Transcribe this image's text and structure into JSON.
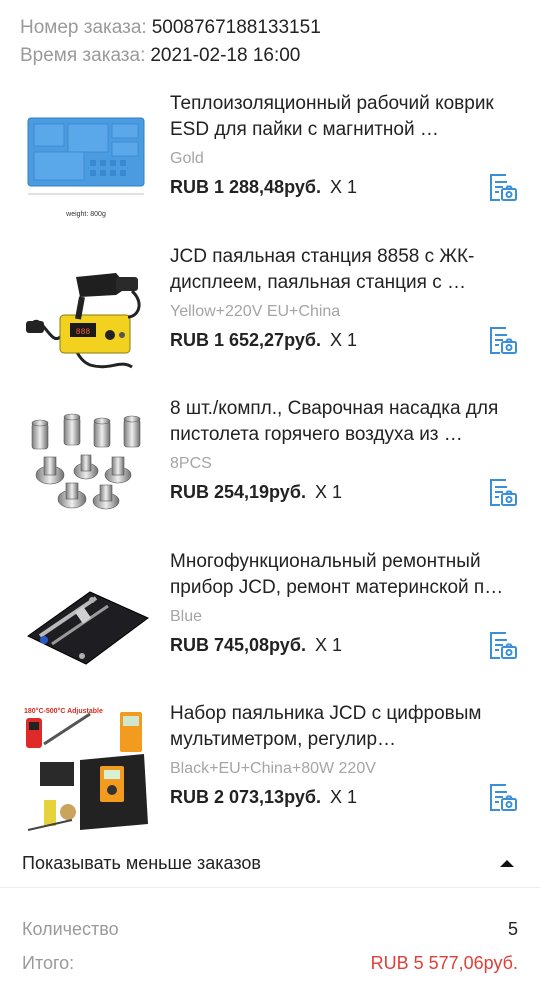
{
  "order": {
    "number_label": "Номер заказа:",
    "number_value": "5008767188133151",
    "time_label": "Время заказа:",
    "time_value": "2021-02-18 16:00"
  },
  "items": [
    {
      "title": "Теплоизоляционный рабочий коврик ESD для пайки с магнитной …",
      "variant": "Gold",
      "price": "RUB 1 288,48руб.",
      "qty": "X 1",
      "image_text": "weight: 800g"
    },
    {
      "title": "JCD паяльная станция 8858 с ЖК-дисплеем, паяльная станция с …",
      "variant": "Yellow+220V EU+China",
      "price": "RUB 1 652,27руб.",
      "qty": "X 1"
    },
    {
      "title": "8 шт./компл., Сварочная насадка для пистолета горячего воздуха из …",
      "variant": "8PCS",
      "price": "RUB 254,19руб.",
      "qty": "X 1"
    },
    {
      "title": "Многофункциональный ремонтный прибор JCD, ремонт материнской п…",
      "variant": "Blue",
      "price": "RUB 745,08руб.",
      "qty": "X 1"
    },
    {
      "title": "Набор паяльника JCD с цифровым мультиметром, регулир…",
      "variant": "Black+EU+China+80W 220V",
      "price": "RUB 2 073,13руб.",
      "qty": "X 1",
      "image_text": "180°C-500°C Adjustable"
    }
  ],
  "toggle": {
    "label": "Показывать меньше заказов",
    "icon": "caret-up-icon"
  },
  "summary": {
    "quantity_label": "Количество",
    "quantity_value": "5",
    "total_label": "Итого:",
    "total_value": "RUB 5 577,06руб."
  },
  "colors": {
    "accent_icon": "#3b8ed8",
    "total": "#e0403a",
    "muted": "#9a9a9a"
  }
}
